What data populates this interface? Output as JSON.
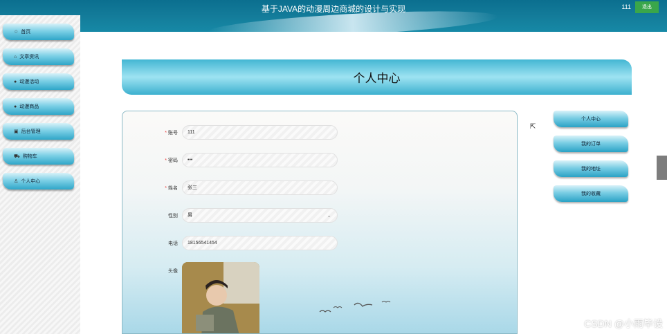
{
  "header": {
    "title": "基于JAVA的动漫周边商城的设计与实现",
    "user": "111",
    "logout_label": "退出"
  },
  "sidebar": {
    "items": [
      {
        "label": "首页",
        "icon": "star-icon"
      },
      {
        "label": "文章资讯",
        "icon": "bag-icon"
      },
      {
        "label": "动漫活动",
        "icon": "dot-icon"
      },
      {
        "label": "动漫商品",
        "icon": "dot-icon"
      },
      {
        "label": "后台管理",
        "icon": "box-icon"
      },
      {
        "label": "购物车",
        "icon": "cart-icon"
      },
      {
        "label": "个人中心",
        "icon": "user-icon"
      }
    ]
  },
  "main": {
    "heading": "个人中心"
  },
  "form": {
    "account": {
      "label": "账号",
      "value": "111",
      "required": true
    },
    "password": {
      "label": "密码",
      "value": "•••",
      "required": true
    },
    "name": {
      "label": "姓名",
      "value": "张三",
      "required": true
    },
    "gender": {
      "label": "性别",
      "value": "男"
    },
    "phone": {
      "label": "电话",
      "value": "18156541454"
    },
    "avatar": {
      "label": "头像"
    }
  },
  "right_menu": {
    "items": [
      {
        "label": "个人中心"
      },
      {
        "label": "我的订单"
      },
      {
        "label": "我的地址"
      },
      {
        "label": "我的收藏"
      }
    ]
  },
  "watermark": "CSDN @小雨毕设",
  "colors": {
    "header": "#147d9b",
    "accent": "#2fa6c8",
    "logout": "#3aa64a",
    "required": "#ee3333"
  }
}
